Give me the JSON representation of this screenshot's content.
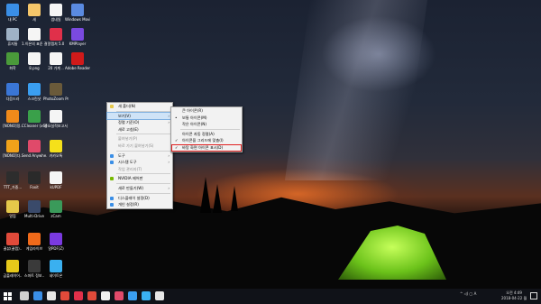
{
  "desktop_icons": [
    {
      "label": "내 PC",
      "color": "#3a8ee6",
      "icon": "computer-icon"
    },
    {
      "label": "휴지통",
      "color": "#9fb2c6",
      "icon": "recycle-bin-icon"
    },
    {
      "label": "화학",
      "color": "#4a9a3a",
      "icon": "chemistry-icon"
    },
    {
      "label": "다음드라",
      "color": "#3a76d6",
      "icon": "daum-drive-icon"
    },
    {
      "label": "[NONO]정..",
      "color": "#f08a1a",
      "icon": "app-icon"
    },
    {
      "label": "[NONO]다..",
      "color": "#f0a21a",
      "icon": "app-icon"
    },
    {
      "label": "TTT_가중...",
      "color": "#2d2d2d",
      "icon": "file-icon"
    },
    {
      "label": "알집",
      "color": "#e6c84a",
      "icon": "alzip-icon"
    },
    {
      "label": "꿀뷰(꿀캠)..",
      "color": "#e04a3a",
      "icon": "honeyview-icon"
    },
    {
      "label": "곰플레이어..",
      "color": "#e6c81a",
      "icon": "gomplayer-icon"
    },
    {
      "label": "새",
      "color": "#f5c66a",
      "icon": "folder-icon"
    },
    {
      "label": "1.이온의 표준 결정",
      "color": "#f5f5f5",
      "icon": "document-icon"
    },
    {
      "label": "8.png",
      "color": "#f5f5f5",
      "icon": "image-icon"
    },
    {
      "label": "스크린샷",
      "color": "#3a9ef0",
      "icon": "screenshot-icon"
    },
    {
      "label": "CCleaner (x64)",
      "color": "#3aa04a",
      "icon": "ccleaner-icon"
    },
    {
      "label": "Send Anywhe..",
      "color": "#e04a6a",
      "icon": "send-anywhere-icon"
    },
    {
      "label": "Foxit",
      "color": "#2a2a2a",
      "icon": "foxit-icon"
    },
    {
      "label": "Multi-Drive",
      "color": "#3a4a6a",
      "icon": "multi-drive-icon"
    },
    {
      "label": "게임라이브",
      "color": "#f06a1a",
      "icon": "game-icon"
    },
    {
      "label": "스마트 정보..",
      "color": "#3a3a3a",
      "icon": "smart-icon"
    },
    {
      "label": "썸네일",
      "color": "#f5f5f5",
      "icon": "image-icon"
    },
    {
      "label": "알캡처 5.0",
      "color": "#e0304a",
      "icon": "alcapture-icon"
    },
    {
      "label": "20 가계 ..",
      "color": "#f5f5f5",
      "icon": "document-icon"
    },
    {
      "label": "PhotoZoom Pro 7",
      "color": "#6a5a3a",
      "icon": "photozoom-icon"
    },
    {
      "label": "중요실적보고서",
      "color": "#f5f5f5",
      "icon": "document-icon"
    },
    {
      "label": "카카오톡",
      "color": "#f5e01a",
      "icon": "kakaotalk-icon"
    },
    {
      "label": "kUPDF",
      "color": "#f5f5f5",
      "icon": "pdf-icon"
    },
    {
      "label": "zCam",
      "color": "#3a9a5a",
      "icon": "zcam-icon"
    },
    {
      "label": "알PDF(Z)",
      "color": "#7a3ae0",
      "icon": "alpdf-icon"
    },
    {
      "label": "네이트온",
      "color": "#3ab0f0",
      "icon": "nateon-icon"
    },
    {
      "label": "Windows Movie Maker",
      "color": "#5a8ae0",
      "icon": "movie-maker-icon"
    },
    {
      "label": "KMPlayer",
      "color": "#7a4ae0",
      "icon": "kmplayer-icon"
    },
    {
      "label": "Adobe Reader DC",
      "color": "#d01a1a",
      "icon": "adobe-reader-icon"
    }
  ],
  "context_menu": {
    "items": [
      {
        "label": "새 폴더(N)",
        "kind": "item",
        "icon": "#e6c84a"
      },
      {
        "label": "보기(V)",
        "kind": "submenu",
        "highlight": true
      },
      {
        "label": "정렬 기준(O)",
        "kind": "submenu"
      },
      {
        "label": "새로 고침(E)",
        "kind": "item"
      },
      {
        "label": "붙여넣기(P)",
        "kind": "disabled"
      },
      {
        "label": "바로 가기 붙여넣기(S)",
        "kind": "disabled"
      },
      {
        "label": "도구",
        "kind": "submenu",
        "icon": "#3a8ee6"
      },
      {
        "label": "시스템 도구",
        "kind": "submenu",
        "icon": "#3a8ee6"
      },
      {
        "label": "작업 관리자(T)",
        "kind": "disabled"
      },
      {
        "label": "NVIDIA 제어판",
        "kind": "item",
        "icon": "#76b900"
      },
      {
        "label": "새로 만들기(W)",
        "kind": "submenu"
      },
      {
        "label": "디스플레이 설정(D)",
        "kind": "item",
        "icon": "#3a8ee6"
      },
      {
        "label": "개인 설정(R)",
        "kind": "item",
        "icon": "#3a8ee6"
      }
    ]
  },
  "view_submenu": {
    "items": [
      {
        "label": "큰 아이콘(R)",
        "mark": ""
      },
      {
        "label": "보통 아이콘(M)",
        "mark": "•"
      },
      {
        "label": "작은 아이콘(N)",
        "mark": ""
      },
      {
        "label": "아이콘 자동 정렬(A)",
        "mark": ""
      },
      {
        "label": "아이콘을 그리드에 맞춤(I)",
        "mark": "✓"
      },
      {
        "label": "바탕 화면 아이콘 표시(D)",
        "mark": "✓",
        "boxed": true
      }
    ]
  },
  "taskbar": {
    "start_icon": "windows-start-icon",
    "pinned": [
      "#d0d0d0",
      "#3a8ee6",
      "#e6e6e6",
      "#e04a3a",
      "#e0304a",
      "#e04a3a",
      "#f0f0f0",
      "#e04a6a",
      "#3a9ef0",
      "#3ab0f0",
      "#e6e6e6"
    ],
    "tray_text": "^  ◁)  ▢  A",
    "time": "오전 4:49",
    "date": "2018-04-22 월"
  }
}
